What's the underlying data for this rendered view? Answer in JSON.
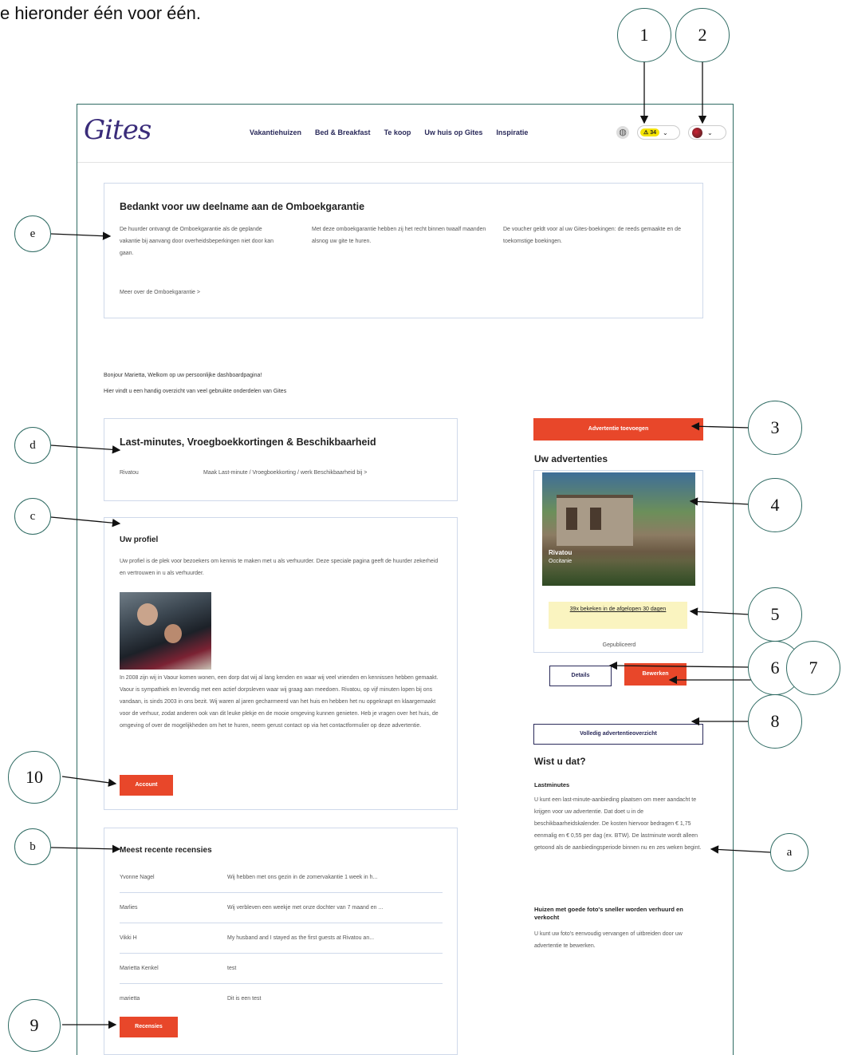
{
  "intro_text": "e hieronder één voor één.",
  "header": {
    "logo": "Gites",
    "nav": [
      "Vakantiehuizen",
      "Bed & Breakfast",
      "Te koop",
      "Uw huis op Gites",
      "Inspiratie"
    ],
    "credits_label": "⚠ 34"
  },
  "guarantee": {
    "title": "Bedankt voor uw deelname aan de Omboekgarantie",
    "col1": "De huurder ontvangt de Omboekgarantie als de geplande vakantie bij aanvang door overheidsbeperkingen niet door kan gaan.",
    "col2": "Met deze omboekgarantie hebben zij het recht binnen twaalf maanden alsnog uw gite te huren.",
    "col3": "De voucher geldt voor al uw Gites-boekingen: de reeds gemaakte en de toekomstige boekingen.",
    "link": "Meer over de Omboekgarantie  >"
  },
  "welcome": {
    "line1": "Bonjour Marietta, Welkom op uw persoonlijke dashboardpagina!",
    "line2": "Hier vindt u een handig overzicht van veel gebruikte onderdelen van Gites"
  },
  "lastminute": {
    "title": "Last-minutes, Vroegboekkortingen & Beschikbaarheid",
    "name": "Rivatou",
    "link": "Maak Last-minute / Vroegboekkorting / werk Beschikbaarheid bij  >"
  },
  "profile": {
    "title": "Uw profiel",
    "intro": "Uw profiel is de plek voor bezoekers om kennis te maken met u als verhuurder. Deze speciale pagina geeft de huurder zekerheid en vertrouwen in u als verhuurder.",
    "bio": "In 2008 zijn wij in Vaour komen wonen, een dorp dat wij al lang kenden en waar wij veel vrienden en kennissen hebben gemaakt. Vaour is sympathiek en levendig met een actief dorpsleven waar wij graag aan meedoen. Rivatou, op vijf minuten lopen bij ons vandaan, is sinds 2003 in ons bezit. Wij waren al jaren gecharmeerd van het huis en hebben het nu opgeknapt en klaargemaakt voor de verhuur, zodat anderen ook van dit leuke plekje en de mooie omgeving kunnen genieten. Heb je vragen over het huis, de omgeving of over de mogelijkheden om het te huren, neem gerust contact op via het contactformulier op deze advertentie.",
    "button": "Account"
  },
  "reviews": {
    "title": "Meest recente recensies",
    "rows": [
      {
        "name": "Yvonne Nagel",
        "text": "Wij hebben met ons gezin in de zomervakantie 1 week in h..."
      },
      {
        "name": "Marlies",
        "text": "Wij verbleven een weekje met onze dochter van 7 maand en ..."
      },
      {
        "name": "Vikki H",
        "text": "My husband and I stayed as the first guests at Rivatou an..."
      },
      {
        "name": "Marietta Kenkel",
        "text": "test"
      },
      {
        "name": "marietta",
        "text": "Dit is een test"
      }
    ],
    "button": "Recensies"
  },
  "sidebar": {
    "add_button": "Advertentie toevoegen",
    "ads_title": "Uw advertenties",
    "photo_caption_1": "Rivatou",
    "photo_caption_2": "Occitanie",
    "views_link": "39x bekeken in de afgelopen 30 dagen",
    "status": "Gepubliceerd",
    "details_button": "Details",
    "edit_button": "Bewerken",
    "overview_button": "Volledig advertentieoverzicht",
    "tips_title": "Wist u dat?",
    "tip1_title": "Lastminutes",
    "tip1_text": "U kunt een last-minute-aanbieding plaatsen om meer aandacht te krijgen voor uw advertentie. Dat doet u in de beschikbaarheidskalender. De kosten hiervoor bedragen € 1,75 eenmalig en € 0,55 per dag (ex. BTW). De lastminute wordt alleen getoond als de aanbiedingsperiode binnen nu en zes weken begint.",
    "tip2_title": "Huizen met goede foto's sneller worden verhuurd en verkocht",
    "tip2_text": "U kunt uw foto's eenvoudig vervangen of uitbreiden door uw advertentie te bewerken."
  },
  "callouts": {
    "c1": "1",
    "c2": "2",
    "c3": "3",
    "c4": "4",
    "c5": "5",
    "c6": "6",
    "c7": "7",
    "c8": "8",
    "c9": "9",
    "c10": "10",
    "ca": "a",
    "cb": "b",
    "cc": "c",
    "cd": "d",
    "ce": "e"
  },
  "colors": {
    "accent": "#e8472a",
    "navy": "#2a2a5a",
    "callout": "#2f6b63",
    "highlight": "#faf4c0"
  }
}
